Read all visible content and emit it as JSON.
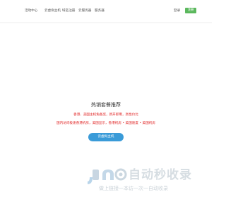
{
  "nav": {
    "items": [
      {
        "label": "活动中心"
      },
      {
        "label": "云虚拟主机"
      },
      {
        "label": "域名注册"
      },
      {
        "label": "云服务器"
      },
      {
        "label": "服务器"
      }
    ],
    "login_label": "登录",
    "register_label": "注册"
  },
  "hero": {
    "title": "热销套餐推荐",
    "promo_line1": "香港、美国主机免备案，新开即用，高性价比",
    "promo_line2": "国内访问极速香港机房，美国显示，香港机房 • 美国速度 • 美国机房",
    "cta_label": "云虚拟主机"
  },
  "watermark": {
    "brand": "自动秒收录",
    "slogan": "做上链接一本访一次一自动收录"
  },
  "colors": {
    "accent_green": "#5bb85d",
    "accent_blue": "#3a9bd8",
    "promo_red": "#e02020"
  }
}
